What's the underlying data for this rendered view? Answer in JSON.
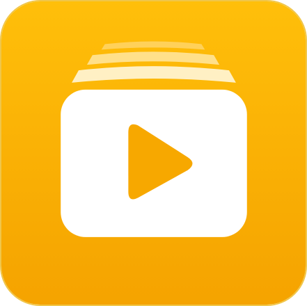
{
  "app_icon": {
    "name": "video-player-app-icon",
    "icon": "stacked-video-play-icon",
    "colors": {
      "gradient_top": "#ffbf0a",
      "gradient_bottom": "#f5a300",
      "glyph": "#ffffff",
      "play": "#f7a800",
      "stack_layer_1": "#ffd15a",
      "stack_layer_2": "#ffe08a",
      "stack_layer_3": "#fff0c4"
    }
  }
}
